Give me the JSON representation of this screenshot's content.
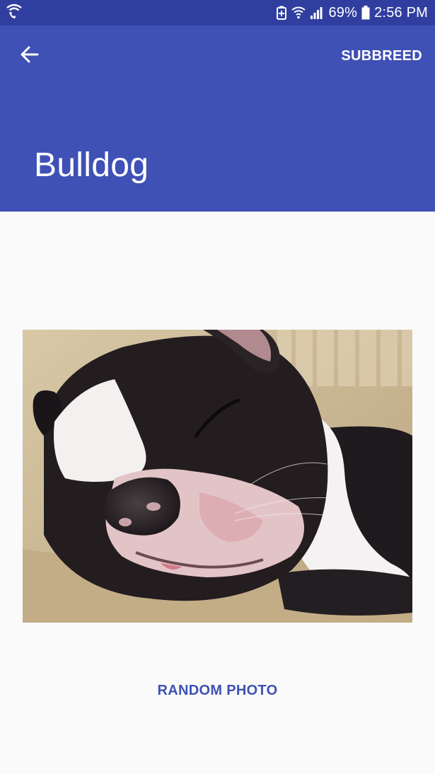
{
  "status_bar": {
    "battery_percent": "69%",
    "time": "2:56 PM",
    "icons": [
      "wifi-calling-icon",
      "battery-saver-icon",
      "wifi-icon",
      "signal-icon",
      "battery-icon"
    ]
  },
  "app_bar": {
    "title": "Bulldog",
    "action_label": "SUBBREED",
    "back_icon": "arrow-back-icon"
  },
  "content": {
    "image_subject": "dog-photo",
    "random_button_label": "RANDOM PHOTO"
  },
  "colors": {
    "status_bar": "#303f9f",
    "primary": "#3f51b5",
    "background": "#fafafa",
    "accent_text": "#3f51b5"
  }
}
